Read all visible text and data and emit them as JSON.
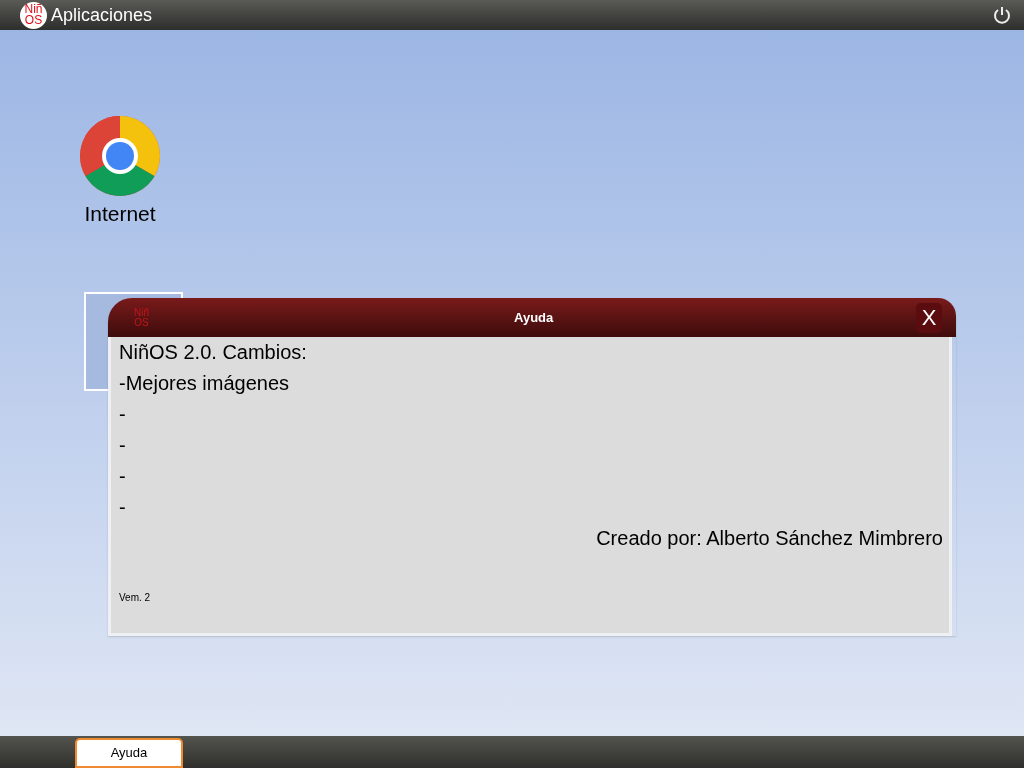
{
  "top_bar": {
    "logo": [
      "Niñ",
      "OS"
    ],
    "title": "Aplicaciones"
  },
  "desktop_icons": [
    {
      "kind": "browser",
      "label": "Internet"
    },
    {
      "kind": "help"
    }
  ],
  "window": {
    "logo": [
      "Niñ",
      "OS"
    ],
    "title": "Ayuda",
    "close": "X",
    "lines": [
      "NiñOS  2.0. Cambios:",
      "-Mejores imágenes",
      "-",
      "-",
      "-",
      "-"
    ],
    "credit": "Creado por: Alberto Sánchez Mimbrero",
    "version": "Vem. 2"
  },
  "taskbar": {
    "items": [
      {
        "label": "Ayuda",
        "selected": true
      }
    ]
  }
}
